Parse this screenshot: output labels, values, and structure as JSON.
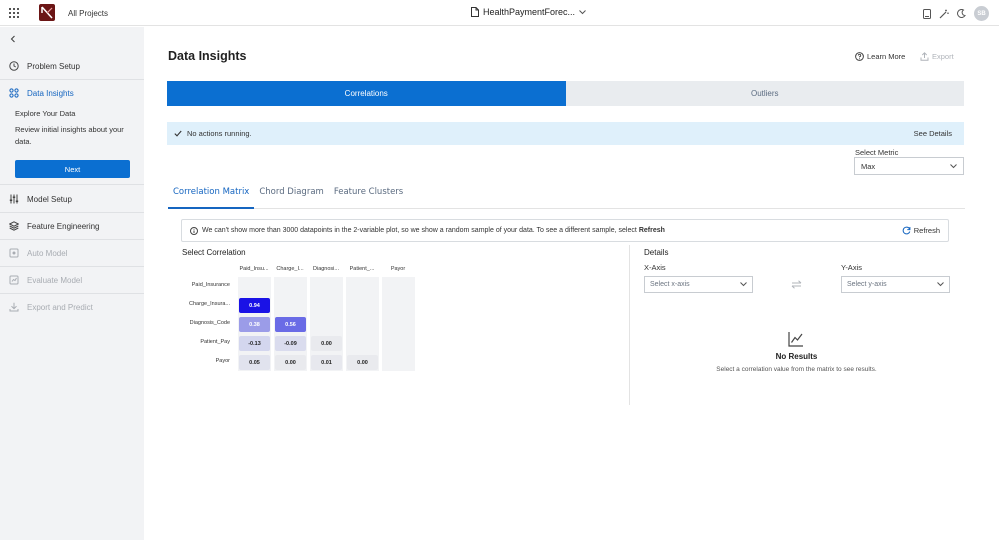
{
  "topbar": {
    "all_projects": "All Projects",
    "project_title": "HealthPaymentForec...",
    "avatar_initials": "SB"
  },
  "sidebar": {
    "items": [
      {
        "label": "Problem Setup",
        "icon": "clock-icon"
      },
      {
        "label": "Data Insights",
        "icon": "insights-icon"
      },
      {
        "label": "Model Setup",
        "icon": "sliders-icon"
      },
      {
        "label": "Feature Engineering",
        "icon": "layers-icon"
      },
      {
        "label": "Auto Model",
        "icon": "auto-model-icon"
      },
      {
        "label": "Evaluate Model",
        "icon": "evaluate-icon"
      },
      {
        "label": "Export and Predict",
        "icon": "download-icon"
      }
    ],
    "explore_title": "Explore Your Data",
    "explore_desc": "Review initial insights about your data.",
    "next_label": "Next"
  },
  "main": {
    "title": "Data Insights",
    "learn_more": "Learn More",
    "export": "Export",
    "tabs": [
      {
        "label": "Correlations",
        "active": true
      },
      {
        "label": "Outliers",
        "active": false
      }
    ],
    "status_text": "No actions running.",
    "see_details": "See Details",
    "metric_label": "Select Metric",
    "metric_value": "Max",
    "sub_tabs": [
      {
        "label": "Correlation Matrix",
        "active": true
      },
      {
        "label": "Chord Diagram",
        "active": false
      },
      {
        "label": "Feature Clusters",
        "active": false
      }
    ],
    "info_text": "We can't show more than 3000 datapoints in the 2-variable plot, so we show a random sample of your data. To see a different sample, select",
    "info_bold": "Refresh",
    "refresh_label": "Refresh",
    "select_correlation": "Select Correlation",
    "details": {
      "title": "Details",
      "x_axis_label": "X-Axis",
      "y_axis_label": "Y-Axis",
      "x_placeholder": "Select x-axis",
      "y_placeholder": "Select y-axis",
      "no_results_title": "No Results",
      "no_results_desc": "Select a correlation value from the matrix to see results."
    }
  },
  "matrix": {
    "columns": [
      "Paid_Insu...",
      "Charge_I...",
      "Diagnosi...",
      "Patient_...",
      "Payor"
    ],
    "rows": [
      "Paid_Insurance",
      "Charge_Insura...",
      "Diagnosis_Code",
      "Patient_Pay",
      "Payor"
    ],
    "cells": [
      [],
      [
        {
          "value": "0.94",
          "color": "#1a12e6",
          "text": "#ffffff"
        }
      ],
      [
        {
          "value": "0.38",
          "color": "#9b9ce8",
          "text": "#ffffff"
        },
        {
          "value": "0.56",
          "color": "#6a6be6",
          "text": "#ffffff"
        }
      ],
      [
        {
          "value": "-0.13",
          "color": "#d3d6ee",
          "text": "#222222"
        },
        {
          "value": "-0.09",
          "color": "#dadcee",
          "text": "#222222"
        },
        {
          "value": "0.00",
          "color": "#e9eaee",
          "text": "#222222"
        }
      ],
      [
        {
          "value": "0.05",
          "color": "#e1e3ee",
          "text": "#222222"
        },
        {
          "value": "0.00",
          "color": "#e9eaee",
          "text": "#222222"
        },
        {
          "value": "0.01",
          "color": "#e7e8ee",
          "text": "#222222"
        },
        {
          "value": "0.00",
          "color": "#e9eaee",
          "text": "#222222"
        }
      ]
    ]
  },
  "colors": {
    "accent": "#0b6fd1",
    "status_bg": "#dff0fb",
    "sidebar_bg": "#f2f3f5"
  }
}
